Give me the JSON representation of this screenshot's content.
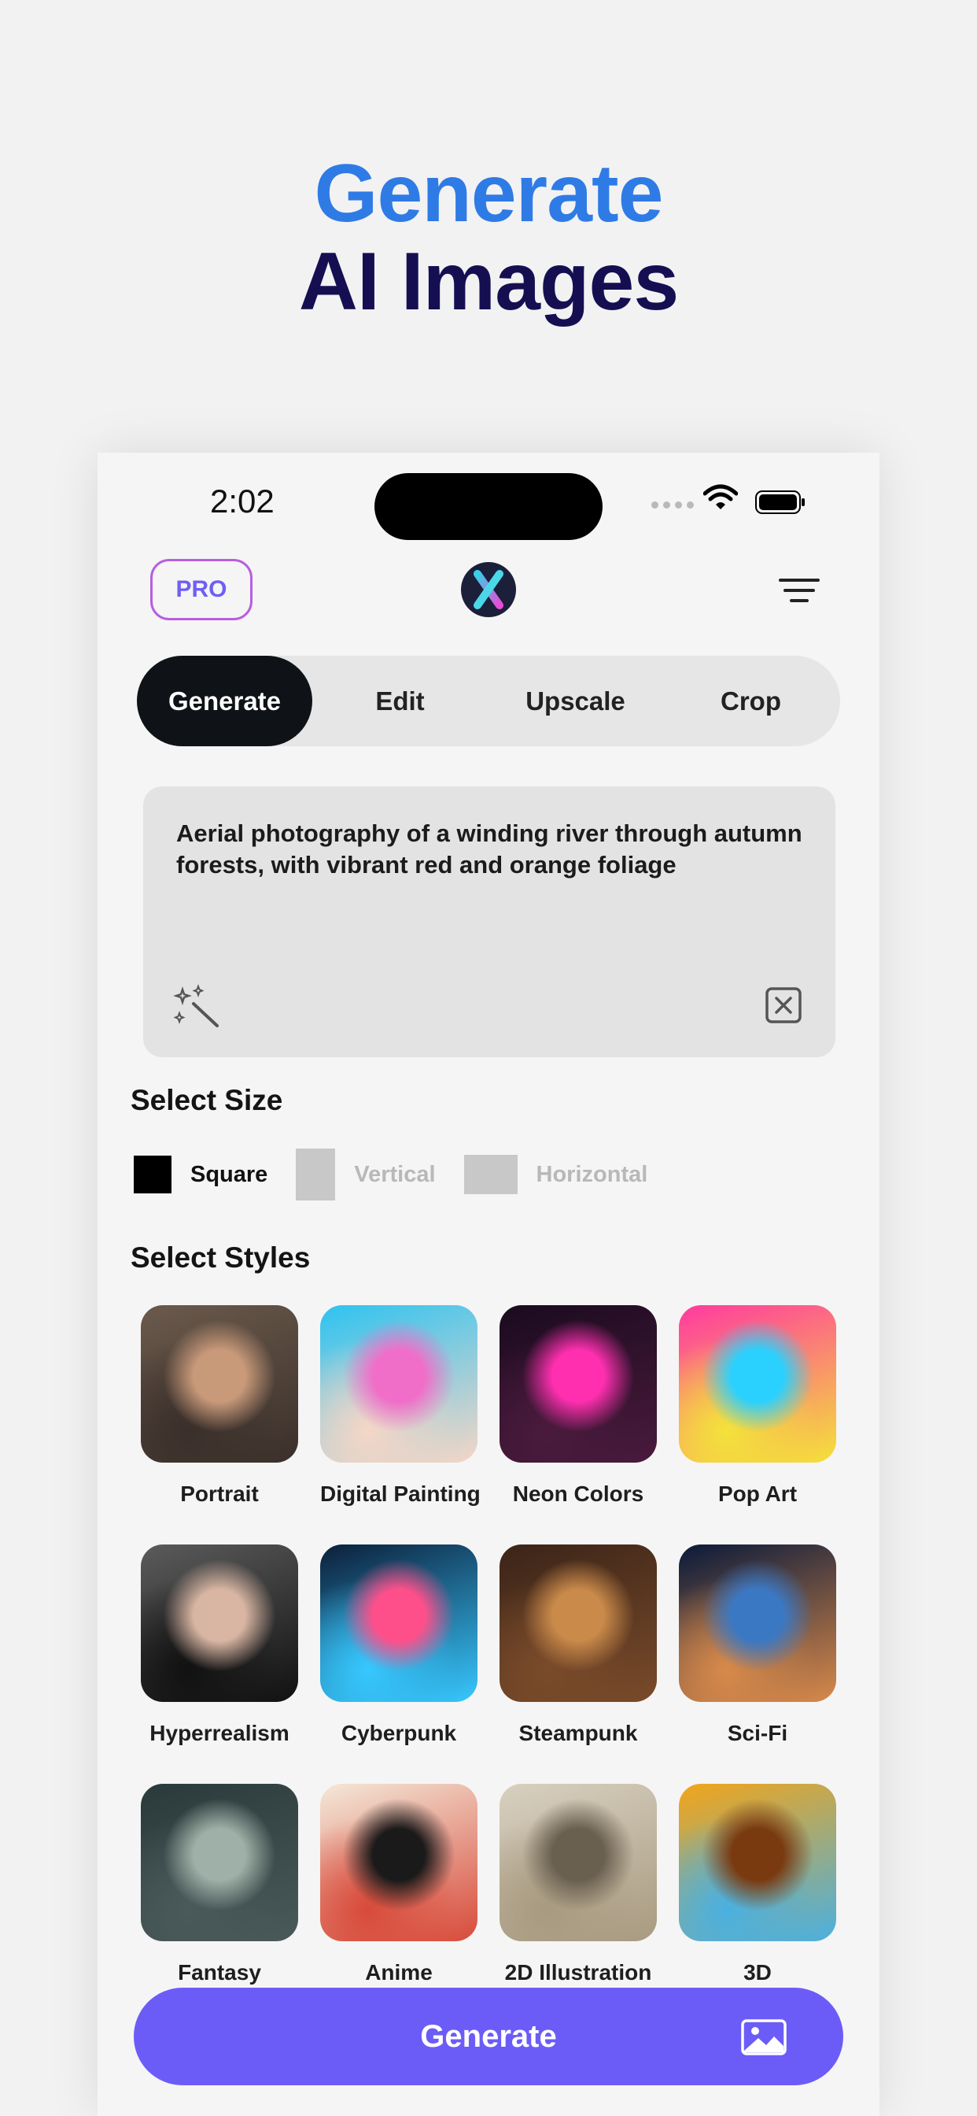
{
  "hero": {
    "line1": "Generate",
    "line2": "AI Images"
  },
  "status_bar": {
    "time": "2:02"
  },
  "header": {
    "pro_label": "PRO"
  },
  "tabs": [
    {
      "label": "Generate",
      "active": true
    },
    {
      "label": "Edit",
      "active": false
    },
    {
      "label": "Upscale",
      "active": false
    },
    {
      "label": "Crop",
      "active": false
    }
  ],
  "prompt": {
    "value": "Aerial photography of a winding river through autumn forests, with vibrant red and orange foliage"
  },
  "size_section": {
    "title": "Select Size",
    "options": [
      {
        "label": "Square",
        "selected": true
      },
      {
        "label": "Vertical",
        "selected": false
      },
      {
        "label": "Horizontal",
        "selected": false
      }
    ]
  },
  "styles_section": {
    "title": "Select Styles",
    "styles": [
      {
        "label": "Portrait",
        "colors": [
          "#6b5a4c",
          "#c99a7a",
          "#3a2f2a"
        ]
      },
      {
        "label": "Digital Painting",
        "colors": [
          "#2ec3f0",
          "#f06ec8",
          "#f5d6c6"
        ]
      },
      {
        "label": "Neon Colors",
        "colors": [
          "#1a0b1f",
          "#ff2fb0",
          "#4a1a3c"
        ]
      },
      {
        "label": "Pop Art",
        "colors": [
          "#ff3aa0",
          "#2ad1ff",
          "#f4e23a"
        ]
      },
      {
        "label": "Hyperrealism",
        "colors": [
          "#5b5b5b",
          "#d9b6a3",
          "#111111"
        ]
      },
      {
        "label": "Cyberpunk",
        "colors": [
          "#0c1f3a",
          "#ff4f8a",
          "#37c8ff"
        ]
      },
      {
        "label": "Steampunk",
        "colors": [
          "#3b2418",
          "#c98a4a",
          "#7a4b2a"
        ]
      },
      {
        "label": "Sci-Fi",
        "colors": [
          "#0a1a3a",
          "#3b78c4",
          "#d98a4a"
        ]
      },
      {
        "label": "Fantasy",
        "colors": [
          "#2a3a3a",
          "#9fb0a8",
          "#4a5a5a"
        ]
      },
      {
        "label": "Anime",
        "colors": [
          "#f4e8d8",
          "#1a1a1a",
          "#d84a3a"
        ]
      },
      {
        "label": "2D Illustration",
        "colors": [
          "#d8d0c0",
          "#6a6050",
          "#a89a80"
        ]
      },
      {
        "label": "3D",
        "colors": [
          "#f2a51a",
          "#7a3a10",
          "#4ab0e0"
        ]
      }
    ]
  },
  "footer": {
    "generate_label": "Generate"
  },
  "colors": {
    "accent": "#6c5cf7",
    "hero_blue": "#2f7be6",
    "hero_navy": "#150f52",
    "pro": "#b85ee0"
  }
}
